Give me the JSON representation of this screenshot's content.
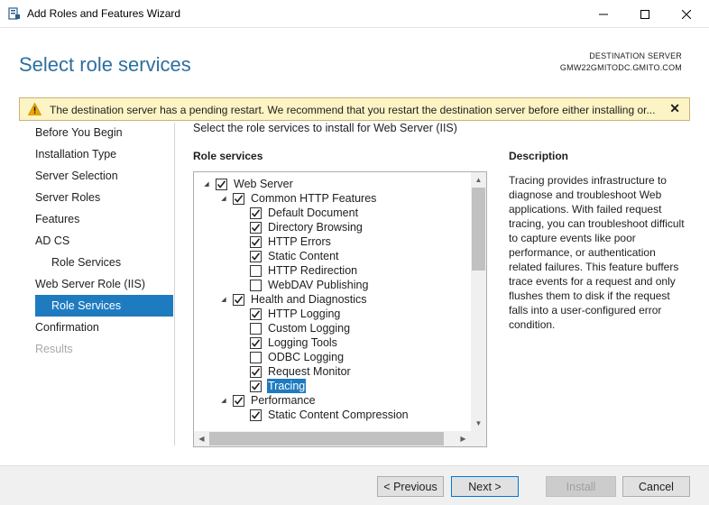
{
  "window": {
    "title": "Add Roles and Features Wizard"
  },
  "header": {
    "page_title": "Select role services",
    "destination_label": "DESTINATION SERVER",
    "destination_value": "GMW22GMITODC.GMITO.COM"
  },
  "warning": {
    "text": "The destination server has a pending restart. We recommend that you restart the destination server before either installing or..."
  },
  "nav": {
    "items": [
      {
        "label": "Before You Begin",
        "state": "normal"
      },
      {
        "label": "Installation Type",
        "state": "normal"
      },
      {
        "label": "Server Selection",
        "state": "normal"
      },
      {
        "label": "Server Roles",
        "state": "normal"
      },
      {
        "label": "Features",
        "state": "normal"
      },
      {
        "label": "AD CS",
        "state": "normal"
      },
      {
        "label": "Role Services",
        "state": "normal"
      },
      {
        "label": "Web Server Role (IIS)",
        "state": "normal"
      },
      {
        "label": "Role Services",
        "state": "selected"
      },
      {
        "label": "Confirmation",
        "state": "normal"
      },
      {
        "label": "Results",
        "state": "disabled"
      }
    ]
  },
  "main": {
    "instruction": "Select the role services to install for Web Server (IIS)",
    "role_services_heading": "Role services",
    "description_heading": "Description",
    "description_text": "Tracing provides infrastructure to diagnose and troubleshoot Web applications. With failed request tracing, you can troubleshoot difficult to capture events like poor performance, or authentication related failures. This feature buffers trace events for a request and only flushes them to disk if the request falls into a user-configured error condition."
  },
  "tree": {
    "rows": [
      {
        "label": "Web Server",
        "checked": true,
        "expander": true
      },
      {
        "label": "Common HTTP Features",
        "checked": true,
        "expander": true
      },
      {
        "label": "Default Document",
        "checked": true
      },
      {
        "label": "Directory Browsing",
        "checked": true
      },
      {
        "label": "HTTP Errors",
        "checked": true
      },
      {
        "label": "Static Content",
        "checked": true
      },
      {
        "label": "HTTP Redirection",
        "checked": false
      },
      {
        "label": "WebDAV Publishing",
        "checked": false
      },
      {
        "label": "Health and Diagnostics",
        "checked": true,
        "expander": true
      },
      {
        "label": "HTTP Logging",
        "checked": true
      },
      {
        "label": "Custom Logging",
        "checked": false
      },
      {
        "label": "Logging Tools",
        "checked": true
      },
      {
        "label": "ODBC Logging",
        "checked": false
      },
      {
        "label": "Request Monitor",
        "checked": true
      },
      {
        "label": "Tracing",
        "checked": true,
        "selected": true
      },
      {
        "label": "Performance",
        "checked": true,
        "expander": true
      },
      {
        "label": "Static Content Compression",
        "checked": true
      }
    ]
  },
  "buttons": {
    "previous": "< Previous",
    "next": "Next >",
    "install": "Install",
    "cancel": "Cancel"
  },
  "colors": {
    "accent": "#1f7bbf",
    "title_blue": "#2e6f9f",
    "warning_bg": "#fcf4c4"
  }
}
